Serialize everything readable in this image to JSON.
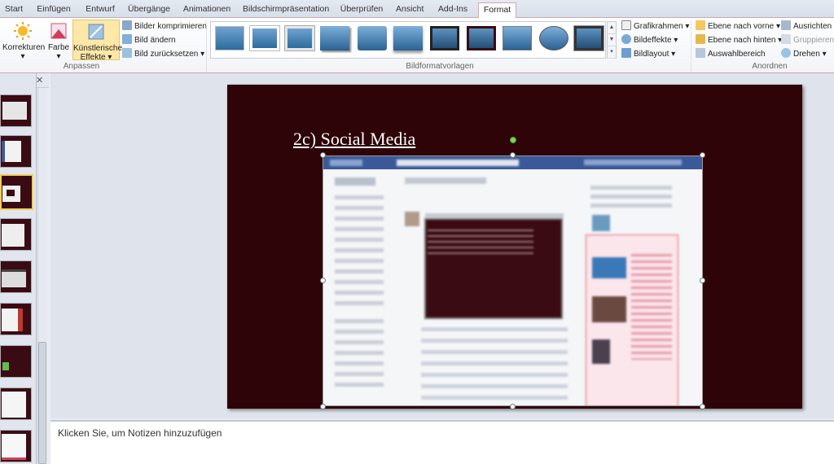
{
  "tabs": [
    "Start",
    "Einfügen",
    "Entwurf",
    "Übergänge",
    "Animationen",
    "Bildschirmpräsentation",
    "Überprüfen",
    "Ansicht",
    "Add-Ins",
    "Format"
  ],
  "active_tab": "Format",
  "ribbon": {
    "anpassen": {
      "label": "Anpassen",
      "korrekturen": "Korrekturen",
      "farbe": "Farbe",
      "kuenstlerische_1": "Künstlerische",
      "kuenstlerische_2": "Effekte",
      "bilder_komprimieren": "Bilder komprimieren",
      "bild_aendern": "Bild ändern",
      "bild_zuruecksetzen": "Bild zurücksetzen"
    },
    "bildformatvorlagen": {
      "label": "Bildformatvorlagen",
      "grafikrahmen": "Grafikrahmen",
      "bildeffekte": "Bildeffekte",
      "bildlayout": "Bildlayout"
    },
    "anordnen": {
      "label": "Anordnen",
      "ebene_vorne": "Ebene nach vorne",
      "ebene_hinten": "Ebene nach hinten",
      "auswahlbereich": "Auswahlbereich",
      "ausrichten": "Ausrichten",
      "gruppieren": "Gruppieren",
      "drehen": "Drehen"
    }
  },
  "slide": {
    "title": "2c) Social Media"
  },
  "notes_placeholder": "Klicken Sie, um Notizen hinzuzufügen",
  "colors": {
    "slide_bg": "#2e0408",
    "accent_border": "#d4a0b6",
    "facebook_blue": "#3b5998"
  },
  "icons": [
    "sun-icon",
    "palette-icon",
    "artistic-effects-icon",
    "compress-icon",
    "change-picture-icon",
    "reset-picture-icon",
    "picture-border-icon",
    "picture-effects-icon",
    "picture-layout-icon",
    "bring-forward-icon",
    "send-backward-icon",
    "selection-pane-icon",
    "align-icon",
    "group-icon",
    "rotate-icon"
  ]
}
